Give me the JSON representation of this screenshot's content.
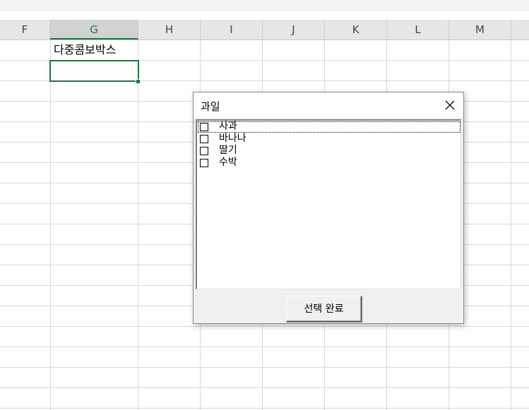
{
  "sheet": {
    "columns": [
      {
        "letter": "F"
      },
      {
        "letter": "G",
        "selected": true
      },
      {
        "letter": "H"
      },
      {
        "letter": "I"
      },
      {
        "letter": "J"
      },
      {
        "letter": "K"
      },
      {
        "letter": "L"
      },
      {
        "letter": "M"
      }
    ],
    "cell_g1_text": "다중콤보박스",
    "accent_color": "#217346"
  },
  "dialog": {
    "title": "과일",
    "close_icon": "close-icon",
    "items": [
      {
        "label": "사과",
        "checked": false,
        "focused": true
      },
      {
        "label": "바나나",
        "checked": false
      },
      {
        "label": "딸기",
        "checked": false
      },
      {
        "label": "수박",
        "checked": false
      }
    ],
    "confirm_label": "선택 완료"
  }
}
